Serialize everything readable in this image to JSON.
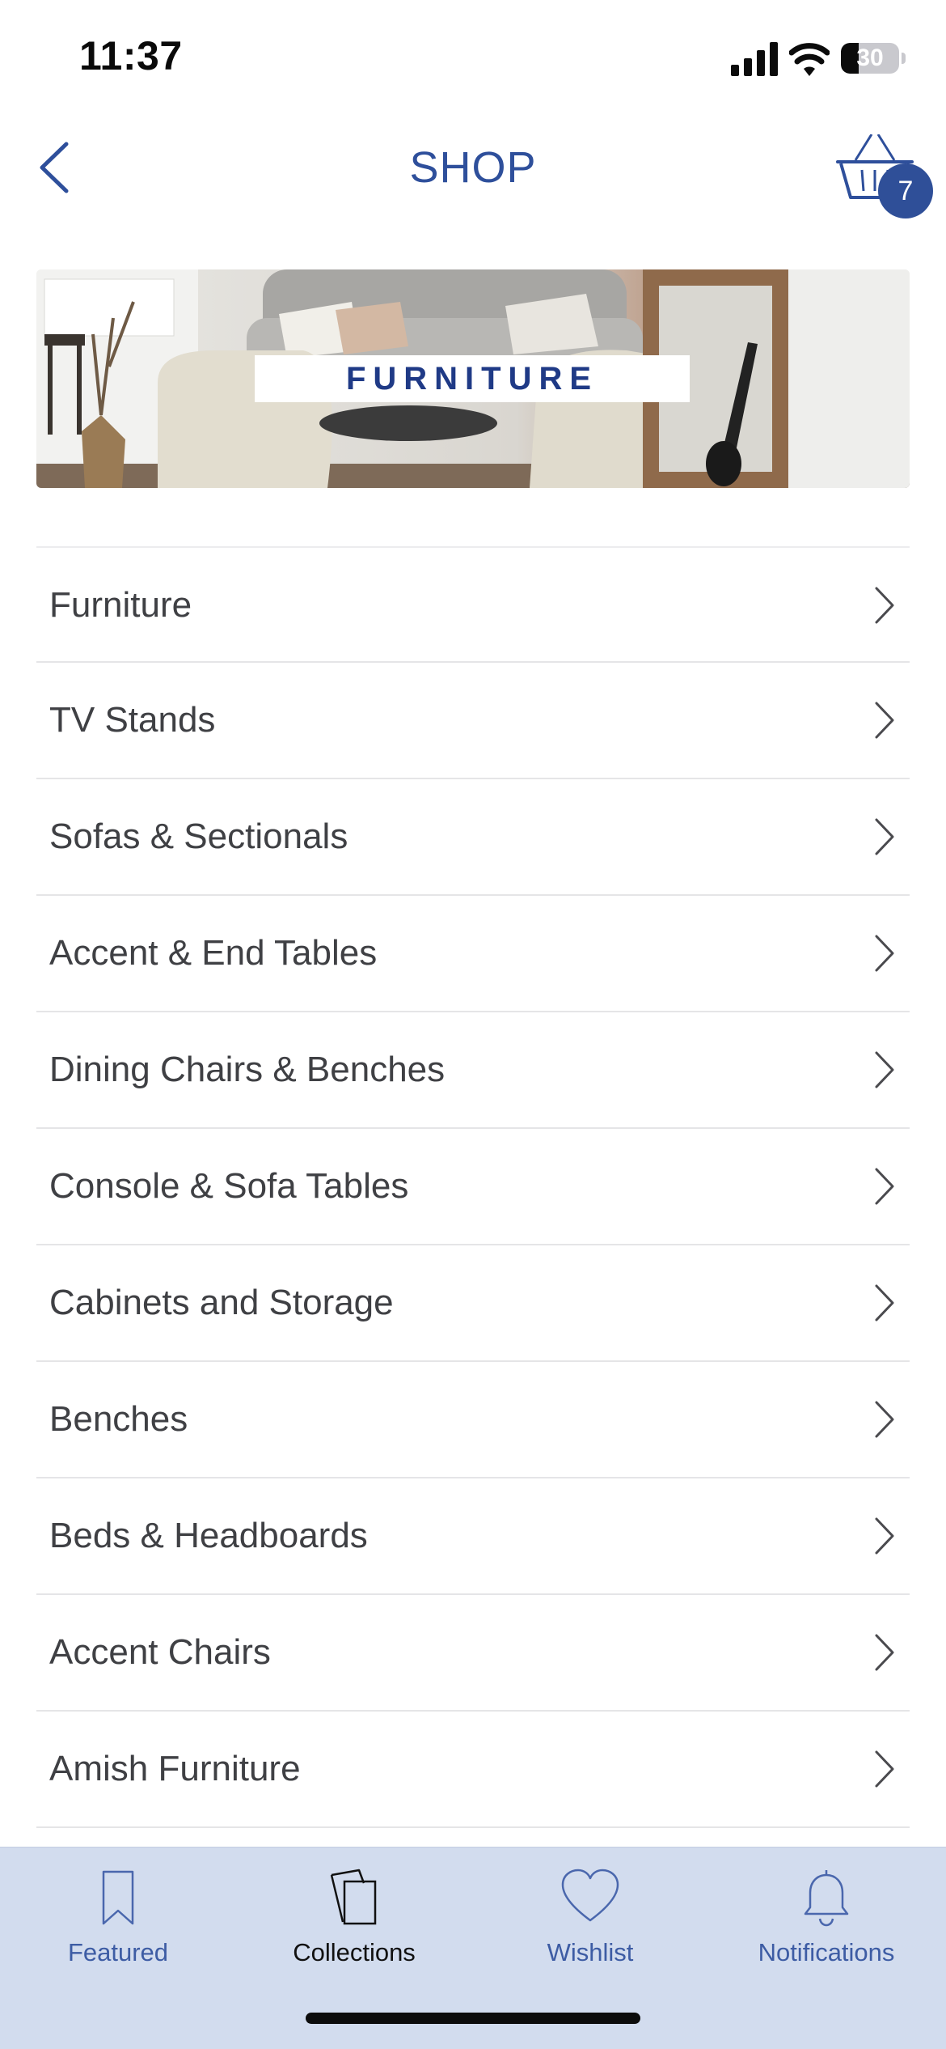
{
  "status_bar": {
    "time": "11:37",
    "battery_level": "30",
    "icons": [
      "signal-icon",
      "wifi-icon",
      "battery-icon"
    ]
  },
  "header": {
    "title": "SHOP",
    "back_icon": "chevron-left-icon",
    "cart_icon": "basket-icon",
    "cart_count": "7"
  },
  "banner": {
    "label": "FURNITURE"
  },
  "categories": [
    {
      "label": "Furniture"
    },
    {
      "label": "TV Stands"
    },
    {
      "label": "Sofas & Sectionals"
    },
    {
      "label": "Accent & End Tables"
    },
    {
      "label": "Dining Chairs & Benches"
    },
    {
      "label": "Console & Sofa Tables"
    },
    {
      "label": "Cabinets and Storage"
    },
    {
      "label": "Benches"
    },
    {
      "label": "Beds & Headboards"
    },
    {
      "label": "Accent Chairs"
    },
    {
      "label": "Amish Furniture"
    }
  ],
  "tab_bar": {
    "tabs": [
      {
        "label": "Featured",
        "icon": "bookmark-icon"
      },
      {
        "label": "Collections",
        "icon": "collections-icon",
        "active": true
      },
      {
        "label": "Wishlist",
        "icon": "heart-icon"
      },
      {
        "label": "Notifications",
        "icon": "bell-icon"
      }
    ]
  },
  "colors": {
    "accent": "#2e4f9b",
    "badge": "#2f4f98",
    "tab_bar_background": "#d2dcee",
    "text": "#3f4044"
  }
}
